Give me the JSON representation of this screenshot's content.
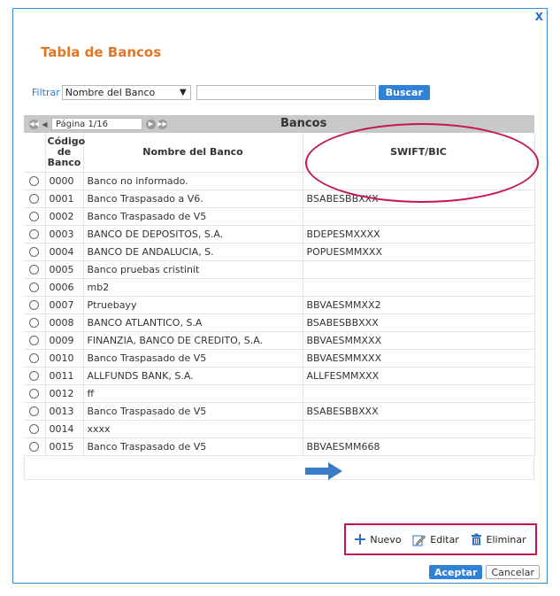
{
  "dialog": {
    "close": "X",
    "title": "Tabla de Bancos"
  },
  "filter": {
    "label": "Filtrar",
    "selected_field": "Nombre del Banco",
    "search_value": "",
    "search_button": "Buscar"
  },
  "grid": {
    "page_label": "Página 1/16",
    "caption": "Bancos",
    "columns": {
      "code": "Código de Banco",
      "name": "Nombre del Banco",
      "swift": "SWIFT/BIC"
    },
    "rows": [
      {
        "code": "0000",
        "name": "Banco no informado.",
        "swift": ""
      },
      {
        "code": "0001",
        "name": "Banco Traspasado a V6.",
        "swift": "BSABESBBXXX"
      },
      {
        "code": "0002",
        "name": "Banco Traspasado de V5",
        "swift": ""
      },
      {
        "code": "0003",
        "name": "BANCO DE DEPOSITOS, S.A.",
        "swift": "BDEPESMXXXX"
      },
      {
        "code": "0004",
        "name": "BANCO DE ANDALUCIA, S.",
        "swift": "POPUESMMXXX"
      },
      {
        "code": "0005",
        "name": "Banco pruebas cristinit",
        "swift": ""
      },
      {
        "code": "0006",
        "name": "mb2",
        "swift": ""
      },
      {
        "code": "0007",
        "name": "Ptruebayy",
        "swift": "BBVAESMMXX2"
      },
      {
        "code": "0008",
        "name": "BANCO ATLANTICO, S.A",
        "swift": "BSABESBBXXX"
      },
      {
        "code": "0009",
        "name": "FINANZIA, BANCO DE CREDITO, S.A.",
        "swift": "BBVAESMMXXX"
      },
      {
        "code": "0010",
        "name": "Banco Traspasado de V5",
        "swift": "BBVAESMMXXX"
      },
      {
        "code": "0011",
        "name": "ALLFUNDS BANK, S.A.",
        "swift": "ALLFESMMXXX"
      },
      {
        "code": "0012",
        "name": "ff",
        "swift": ""
      },
      {
        "code": "0013",
        "name": "Banco Traspasado de V5",
        "swift": "BSABESBBXXX"
      },
      {
        "code": "0014",
        "name": "xxxx",
        "swift": ""
      },
      {
        "code": "0015",
        "name": "Banco Traspasado de V5",
        "swift": "BBVAESMM668"
      }
    ]
  },
  "actions": {
    "new": "Nuevo",
    "edit": "Editar",
    "delete": "Eliminar"
  },
  "footer": {
    "accept": "Aceptar",
    "cancel": "Cancelar"
  },
  "colors": {
    "accent": "#2f82d6",
    "title": "#e07828",
    "highlight": "#c4164f"
  },
  "icons": {
    "close": "close-icon",
    "select": "chevron-down-icon",
    "first": "first-page-icon",
    "prev": "prev-page-icon",
    "next": "next-page-icon",
    "last": "last-page-icon",
    "new": "plus-icon",
    "edit": "pencil-icon",
    "delete": "trash-icon",
    "pointer": "arrow-right-icon"
  }
}
